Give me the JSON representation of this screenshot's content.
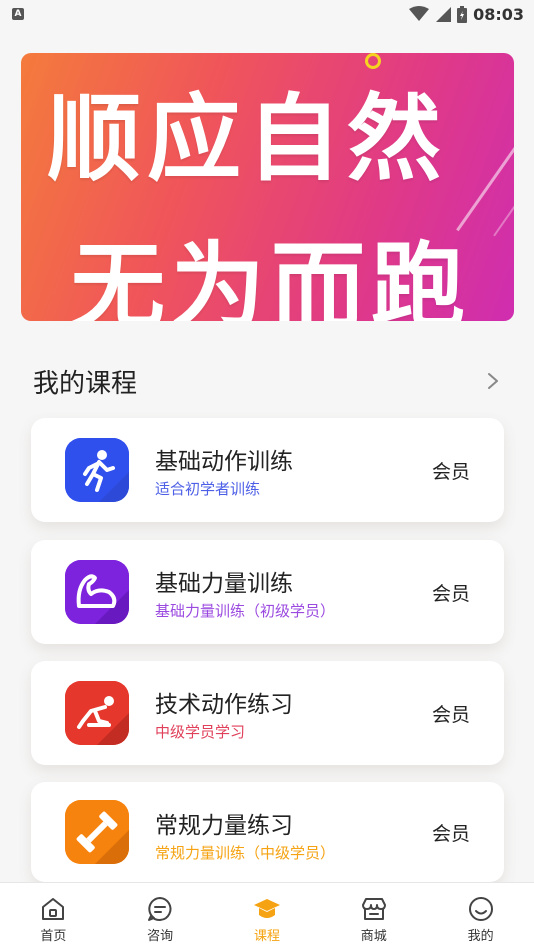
{
  "status_bar": {
    "left_icon": "A",
    "time": "08:03",
    "icons": [
      "wifi-icon",
      "signal-icon",
      "battery-icon"
    ]
  },
  "banner": {
    "line1": "顺应自然",
    "line2": "无为而跑"
  },
  "section": {
    "title": "我的课程"
  },
  "courses": [
    {
      "title": "基础动作训练",
      "subtitle": "适合初学者训练",
      "badge": "会员",
      "icon": "running-man-icon",
      "icon_color": "#3d5af1",
      "subtitle_color": "#4d5fe6"
    },
    {
      "title": "基础力量训练",
      "subtitle": "基础力量训练（初级学员）",
      "badge": "会员",
      "icon": "flexed-arm-icon",
      "icon_color": "#8a2be2",
      "subtitle_color": "#9b4ae0"
    },
    {
      "title": "技术动作练习",
      "subtitle": "中级学员学习",
      "badge": "会员",
      "icon": "sprint-start-icon",
      "icon_color": "#e63a2e",
      "subtitle_color": "#e0405a"
    },
    {
      "title": "常规力量练习",
      "subtitle": "常规力量训练（中级学员）",
      "badge": "会员",
      "icon": "dumbbell-icon",
      "icon_color": "#f7830f",
      "subtitle_color": "#f5a312"
    }
  ],
  "nav": {
    "items": [
      {
        "label": "首页",
        "icon": "home-icon"
      },
      {
        "label": "咨询",
        "icon": "chat-icon"
      },
      {
        "label": "课程",
        "icon": "graduation-cap-icon",
        "active": true
      },
      {
        "label": "商城",
        "icon": "store-icon"
      },
      {
        "label": "我的",
        "icon": "profile-icon"
      }
    ],
    "active_color": "#f5a312"
  }
}
